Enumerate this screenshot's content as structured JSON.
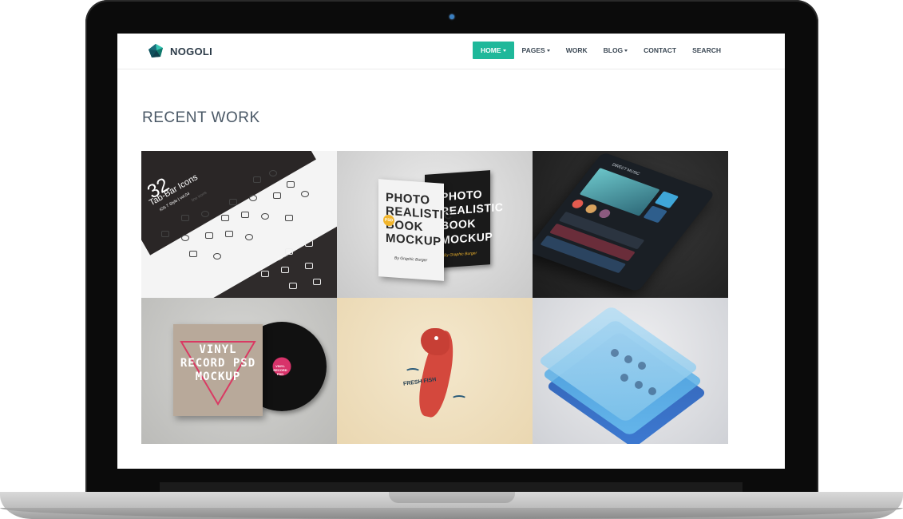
{
  "brand": {
    "name": "NOGOLI"
  },
  "nav": {
    "items": [
      {
        "label": "HOME",
        "dropdown": true,
        "active": true
      },
      {
        "label": "PAGES",
        "dropdown": true,
        "active": false
      },
      {
        "label": "WORK",
        "dropdown": false,
        "active": false
      },
      {
        "label": "BLOG",
        "dropdown": true,
        "active": false
      },
      {
        "label": "CONTACT",
        "dropdown": false,
        "active": false
      },
      {
        "label": "SEARCH",
        "dropdown": false,
        "active": false
      }
    ]
  },
  "section": {
    "title": "RECENT WORK"
  },
  "portfolio": {
    "tile1": {
      "line1": "32",
      "line2": "Tab-Bar Icons",
      "line3": "iOS 7 Style | vol.04",
      "line4": "line icons",
      "line5": "full icons"
    },
    "tile2": {
      "front_title": "PHOTO REALISTIC BOOK MOCKUP",
      "front_sub": "By Graphic Burger",
      "back_title": "PHOTO REALISTIC BOOK MOCKUP",
      "back_sub": "By Graphic Burger",
      "badge": "PSD"
    },
    "tile3": {
      "app_title": "DIRECT MUSIC"
    },
    "tile4": {
      "sleeve_text": "VINYL RECORD PSD MOCKUP",
      "label_text": "VINYL RECORD PSD"
    },
    "tile5": {
      "fish_text": "FRESH FISH"
    },
    "tile6": {}
  },
  "colors": {
    "accent": "#1fb89a",
    "nav_text": "#3d4a56",
    "title_text": "#4a5866",
    "brand_text": "#2b3a47"
  }
}
